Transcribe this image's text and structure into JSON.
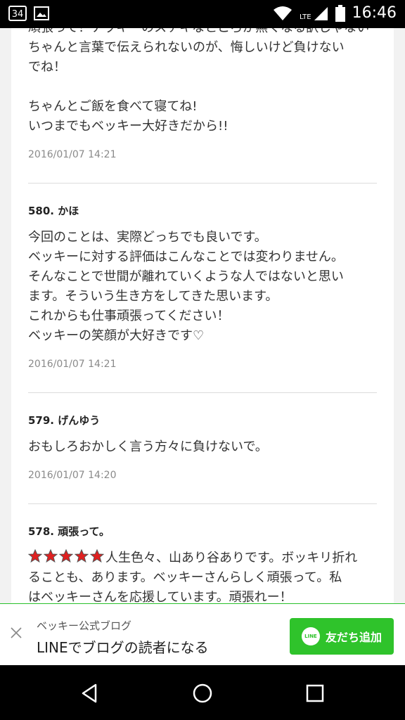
{
  "statusbar": {
    "notif_count": "34",
    "network": "LTE",
    "time": "16:46"
  },
  "comments_top": {
    "cut_line": "頑張って！ナッキーのステキなところが無くなる訳じゃないよ!!",
    "text": "ちゃんと言葉で伝えられないのが、悔しいけど負けない\nでね！\n\nちゃんとご飯を食べて寝てね!\nいつまでもベッキー大好きだから!!",
    "date": "2016/01/07 14:21"
  },
  "comments": [
    {
      "number": "580.",
      "author": "かほ",
      "text": "今回のことは、実際どっちでも良いです。\nベッキーに対する評価はこんなことでは変わりません。\nそんなことで世間が離れていくような人ではないと思い\nます。そういう生き方をしてきた思います。\nこれからも仕事頑張ってください！\nベッキーの笑顔が大好きです♡",
      "date": "2016/01/07 14:21"
    },
    {
      "number": "579.",
      "author": "げんゆう",
      "text": "おもしろおかしく言う方々に負けないで。",
      "date": "2016/01/07 14:20"
    },
    {
      "number": "578.",
      "author": "頑張って。",
      "stars": 5,
      "text_first": "人生色々、山あり谷ありです。ボッキリ折れ",
      "text_rest": "ることも、あります。ベッキーさんらしく頑張って。私\nはベッキーさんを応援しています。頑張れー！"
    }
  ],
  "banner": {
    "subtitle": "ベッキー公式ブログ",
    "title": "LINEでブログの読者になる",
    "button_label": "友だち追加",
    "logo_text": "LINE",
    "accent_color": "#2fc32b"
  },
  "icons": [
    "notification-icon",
    "image-icon",
    "wifi-icon",
    "signal-icon",
    "battery-icon",
    "close-icon",
    "back-icon",
    "home-icon",
    "recents-icon"
  ]
}
